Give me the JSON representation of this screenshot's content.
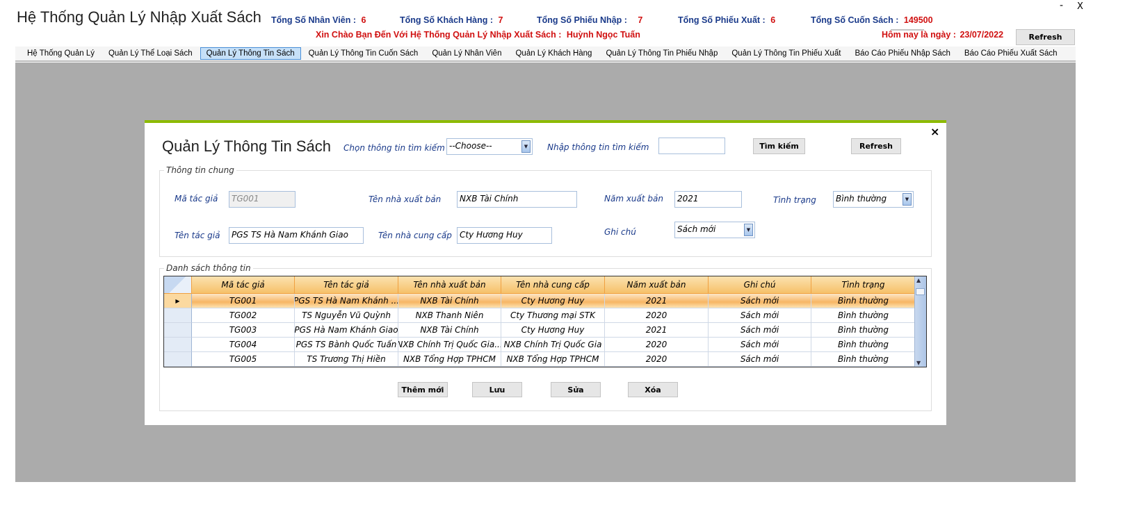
{
  "app": {
    "title": "Hệ Thống Quản Lý Nhập Xuất Sách",
    "minimize": "-",
    "close": "X"
  },
  "stats": [
    {
      "label": "Tổng Số Nhân Viên :",
      "value": "6"
    },
    {
      "label": "Tổng Số Khách Hàng :",
      "value": "7"
    },
    {
      "label": "Tổng Số Phiếu Nhập :",
      "value": "7"
    },
    {
      "label": "Tổng Số Phiếu Xuất :",
      "value": "6"
    },
    {
      "label": "Tổng Số Cuốn Sách :",
      "value": "149500"
    }
  ],
  "welcome": {
    "label": "Xin Chào Bạn Đến Với Hệ Thống Quản Lý Nhập Xuất Sách :",
    "user": "Huỳnh Ngọc Tuấn"
  },
  "today": {
    "label": "Hôm nay là ngày :",
    "value": "23/07/2022"
  },
  "refresh_label": "Refresh",
  "menu": [
    "Hệ Thống Quản Lý",
    "Quản Lý Thể Loại Sách",
    "Quản Lý Thông Tin Sách",
    "Quản Lý Thông Tin Cuốn Sách",
    "Quản Lý Nhân Viên",
    "Quản Lý Khách Hàng",
    "Quản Lý Thông Tin Phiếu Nhập",
    "Quản Lý Thông Tin Phiếu Xuất",
    "Báo Cáo Phiếu Nhập Sách",
    "Báo Cáo Phiếu Xuất Sách"
  ],
  "active_menu": "Quản Lý Thông Tin Sách",
  "dialog": {
    "close": "×",
    "title": "Quản Lý Thông Tin Sách",
    "search_choose_label": "Chọn thông tin tìm kiếm",
    "search_choose_value": "--Choose--",
    "search_input_label": "Nhập thông tin tìm kiếm",
    "search_input_value": "",
    "search_button": "Tìm kiếm",
    "refresh_button": "Refresh",
    "general_group": "Thông tin chung",
    "fields": {
      "ma_tac_gia": {
        "label": "Mã tác giả",
        "value": "TG001"
      },
      "ten_tac_gia": {
        "label": "Tên tác giả",
        "value": "PGS TS Hà Nam Khánh Giao"
      },
      "ten_nxb": {
        "label": "Tên nhà xuất bản",
        "value": "NXB Tài Chính"
      },
      "ten_ncc": {
        "label": "Tên nhà cung cấp",
        "value": "Cty Hương Huy"
      },
      "nam_xb": {
        "label": "Năm xuất bản",
        "value": "2021"
      },
      "ghi_chu": {
        "label": "Ghi chú",
        "value": "Sách mới"
      },
      "tinh_trang": {
        "label": "Tình trạng",
        "value": "Bình thường"
      }
    },
    "list_group": "Danh sách thông tin",
    "columns": [
      "Mã tác giả",
      "Tên tác giả",
      "Tên nhà xuất bản",
      "Tên nhà cung cấp",
      "Năm xuất bản",
      "Ghi chú",
      "Tình trạng"
    ],
    "rows": [
      [
        "TG001",
        "PGS TS Hà Nam Khánh ...",
        "NXB Tài Chính",
        "Cty Hương Huy",
        "2021",
        "Sách mới",
        "Bình thường"
      ],
      [
        "TG002",
        "TS Nguyễn Vũ Quỳnh",
        "NXB Thanh Niên",
        "Cty Thương mại STK",
        "2020",
        "Sách mới",
        "Bình thường"
      ],
      [
        "TG003",
        "PGS Hà Nam Khánh Giao",
        "NXB Tài Chính",
        "Cty Hương Huy",
        "2021",
        "Sách mới",
        "Bình thường"
      ],
      [
        "TG004",
        "PGS TS Bành Quốc Tuấn",
        "NXB Chính Trị Quốc Gia...",
        "NXB Chính Trị Quốc Gia",
        "2020",
        "Sách mới",
        "Bình thường"
      ],
      [
        "TG005",
        "TS Trương Thị Hiền",
        "NXB Tổng Hợp TPHCM",
        "NXB Tổng Hợp TPHCM",
        "2020",
        "Sách mới",
        "Bình thường"
      ]
    ],
    "selected_row": 0,
    "buttons": [
      "Thêm mới",
      "Lưu",
      "Sửa",
      "Xóa"
    ]
  },
  "colors": {
    "accent_green": "#8cba00",
    "stat_blue": "#1a3a8a",
    "value_red": "#d01010",
    "grid_header": "#f6c16a"
  }
}
